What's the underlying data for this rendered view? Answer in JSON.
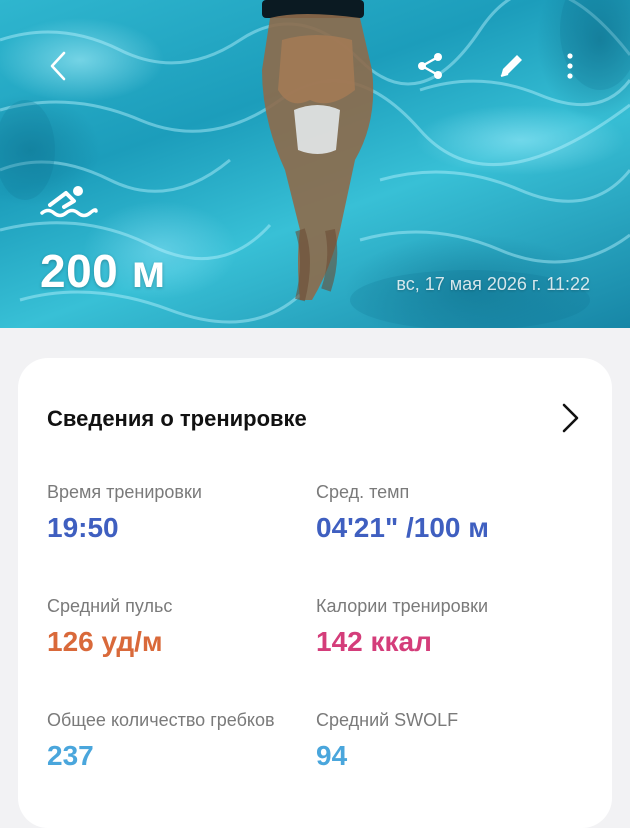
{
  "header": {
    "distance": "200 м",
    "datetime": "вс, 17 мая 2026 г. 11:22",
    "activity_icon": "swimming-icon",
    "back_icon": "chevron-left-icon",
    "share_icon": "share-icon",
    "edit_icon": "pencil-icon",
    "more_icon": "more-vertical-icon"
  },
  "details": {
    "title": "Сведения о тренировке",
    "metrics": [
      {
        "label": "Время тренировки",
        "value": "19:50",
        "color": "#3f5fc0"
      },
      {
        "label": "Сред. темп",
        "value": "04'21\" /100 м",
        "color": "#3f5fc0"
      },
      {
        "label": "Средний пульс",
        "value": "126 уд/м",
        "color": "#d9693a"
      },
      {
        "label": "Калории тренировки",
        "value": "142 ккал",
        "color": "#d43d7a"
      },
      {
        "label": "Общее количество гребков",
        "value": "237",
        "color": "#4aa6dc"
      },
      {
        "label": "Средний SWOLF",
        "value": "94",
        "color": "#4aa6dc"
      }
    ]
  }
}
